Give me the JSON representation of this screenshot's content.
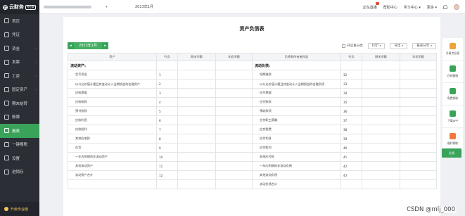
{
  "app": {
    "logo_text": "云财务",
    "logo_badge": "专业版"
  },
  "sidebar": {
    "items": [
      {
        "label": "首页",
        "icon": "home-icon",
        "active": false,
        "arrow": false
      },
      {
        "label": "凭证",
        "icon": "voucher-icon",
        "active": false,
        "arrow": false
      },
      {
        "label": "资金",
        "icon": "fund-icon",
        "active": false,
        "arrow": true
      },
      {
        "label": "发票",
        "icon": "invoice-icon",
        "active": false,
        "arrow": true
      },
      {
        "label": "工资",
        "icon": "salary-icon",
        "active": false,
        "arrow": true
      },
      {
        "label": "固定资产",
        "icon": "asset-icon",
        "active": false,
        "arrow": true
      },
      {
        "label": "期末结转",
        "icon": "closing-icon",
        "active": false,
        "arrow": false
      },
      {
        "label": "账簿",
        "icon": "ledger-icon",
        "active": false,
        "arrow": false
      },
      {
        "label": "报表",
        "icon": "report-icon",
        "active": true,
        "arrow": false
      },
      {
        "label": "一键报税",
        "icon": "tax-icon",
        "active": false,
        "arrow": false
      },
      {
        "label": "设置",
        "icon": "settings-icon",
        "active": false,
        "arrow": false
      },
      {
        "label": "进销存",
        "icon": "inventory-icon",
        "active": false,
        "arrow": false
      }
    ],
    "upgrade_label": "升级专业版"
  },
  "topbar": {
    "period": "2023年1月",
    "live": "正在直播",
    "help": "帮助中心",
    "learn": "学习中心",
    "more": "更多"
  },
  "report": {
    "title": "资产负债表",
    "period_label": "2023年1月",
    "prev": "◂",
    "next": "▸",
    "checkbox_label": "开启重分类",
    "print": "打印",
    "export": "导出",
    "share": "报表分享"
  },
  "table": {
    "headers": [
      "资产",
      "行次",
      "期末余额",
      "年初余额",
      "负债和所有者权益",
      "行次",
      "期末余额",
      "年初余额"
    ],
    "rows": [
      {
        "left": "流动资产:",
        "lline": "",
        "lsec": true,
        "right": "流动负债:",
        "rline": "",
        "rsec": true
      },
      {
        "left": "货币资金",
        "lline": "1",
        "right": "短期借款",
        "rline": "32"
      },
      {
        "left": "以公允价值计量且其变动计入当期损益的金融资产",
        "lline": "2",
        "lwrap": true,
        "right": "以公允价值计量且其变动计入当期损益的金融负债",
        "rline": "33",
        "rwrap": true
      },
      {
        "left": "应收票据",
        "lline": "3",
        "right": "应付票据",
        "rline": "34"
      },
      {
        "left": "应收账款",
        "lline": "4",
        "right": "应付账款",
        "rline": "35"
      },
      {
        "left": "预付账款",
        "lline": "5",
        "right": "预收款项",
        "rline": "36"
      },
      {
        "left": "应收利息",
        "lline": "6",
        "right": "应付职工薪酬",
        "rline": "37"
      },
      {
        "left": "应收股利",
        "lline": "7",
        "right": "应交税费",
        "rline": "38"
      },
      {
        "left": "其他应收款",
        "lline": "8",
        "right": "应付利息",
        "rline": "39"
      },
      {
        "left": "存货",
        "lline": "9",
        "right": "应付股利",
        "rline": "40"
      },
      {
        "left": "一年内到期的非流动资产",
        "lline": "10",
        "right": "其他应付款",
        "rline": "41"
      },
      {
        "left": "其他流动资产",
        "lline": "11",
        "right": "一年内到期的非流动负债",
        "rline": "42"
      },
      {
        "left": "流动资产合计",
        "lline": "12",
        "right": "其他流动负债",
        "rline": "43"
      },
      {
        "left": "",
        "lline": "",
        "right": "流动负债合计",
        "rline": ""
      }
    ]
  },
  "rpanel": [
    {
      "label": "升级专业版",
      "icon": "crown-icon",
      "color": "#f0a23a"
    },
    {
      "label": "在线客服",
      "icon": "headset-icon",
      "color": "#3aa35a"
    },
    {
      "label": "免费领取",
      "icon": "gift-icon",
      "color": "#3aa35a"
    },
    {
      "label": "下载APP",
      "icon": "phone-icon",
      "color": "#3aa35a"
    },
    {
      "label": "福利领取",
      "icon": "present-icon",
      "color": "#f07a3a"
    }
  ],
  "feedback": "反馈",
  "watermark": "CSDN @mlj_000"
}
